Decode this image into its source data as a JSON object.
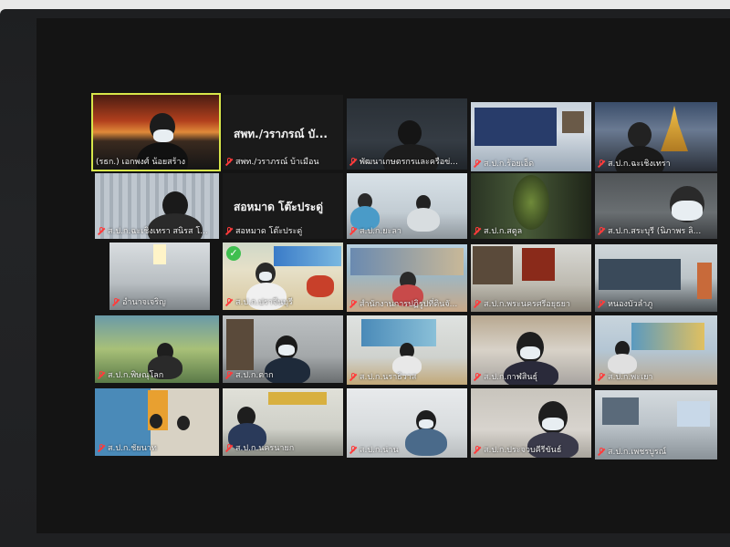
{
  "participants": [
    {
      "id": "p1",
      "label": "(รธก.) เอกพงศ์ น้อยสร้าง",
      "muted": false,
      "active": true
    },
    {
      "id": "p2",
      "label": "สพท./วราภรณ์ บ้าเมือน",
      "muted": true,
      "big_label": "สพท./วราภรณ์ บั..."
    },
    {
      "id": "p3",
      "label": "พัฒนาเกษตรกรและครือข่...",
      "muted": true
    },
    {
      "id": "p4",
      "label": "ส.ป.ก.ร้อยเอ็ด",
      "muted": true
    },
    {
      "id": "p5",
      "label": "ส.ป.ก.ฉะเชิงเทรา",
      "muted": true
    },
    {
      "id": "p6",
      "label": "ส.ป.ก.ฉะเชิงเทรา สนิรส โ...",
      "muted": true
    },
    {
      "id": "p7",
      "label": "สอหมาด โต๊ะประดู่",
      "muted": true,
      "big_label": "สอหมาด  โต๊ะประดู่"
    },
    {
      "id": "p8",
      "label": "ส.ป.ก.ยะลา",
      "muted": true
    },
    {
      "id": "p9",
      "label": "ส.ป.ก.สตูล",
      "muted": true
    },
    {
      "id": "p10",
      "label": "ส.ป.ก.สระบุรี (นิภาพร ลิ...",
      "muted": true
    },
    {
      "id": "p11",
      "label": "อำนาจเจริญ",
      "muted": true
    },
    {
      "id": "p12",
      "label": "ส.ป.ก.ปราจีนบุรี",
      "muted": true
    },
    {
      "id": "p13",
      "label": "สำนักงานการปฏิรูปที่ดินจั...",
      "muted": true
    },
    {
      "id": "p14",
      "label": "ส.ป.ก.พระนครศรีอยุธยา",
      "muted": true
    },
    {
      "id": "p15",
      "label": "หนองบัวลำภู",
      "muted": true
    },
    {
      "id": "p16",
      "label": "ส.ป.ก.พิษณุโลก",
      "muted": true
    },
    {
      "id": "p17",
      "label": "ส.ป.ก.ตาก",
      "muted": true
    },
    {
      "id": "p18",
      "label": "ส.ป.ก.นราธิวาส",
      "muted": true
    },
    {
      "id": "p19",
      "label": "ส.ป.ก.กาฬสินธุ์",
      "muted": true
    },
    {
      "id": "p20",
      "label": "ส.ป.ก.พะเยา",
      "muted": true
    },
    {
      "id": "p21",
      "label": "ส.ป.ก.ชัยนาท",
      "muted": true
    },
    {
      "id": "p22",
      "label": "ส.ป.ก.นครนายก",
      "muted": true
    },
    {
      "id": "p23",
      "label": "ส.ป.ก.น่าน",
      "muted": true
    },
    {
      "id": "p24",
      "label": "ส.ป.ก.ประจวบคีรีขันธ์",
      "muted": true
    },
    {
      "id": "p25",
      "label": "ส.ป.ก.เพชรบูรณ์",
      "muted": true
    }
  ],
  "colors": {
    "mute_icon": "#ff3b3b",
    "active_speaker_border": "#d7e64a",
    "tile_bg": "#2b2c2e"
  }
}
